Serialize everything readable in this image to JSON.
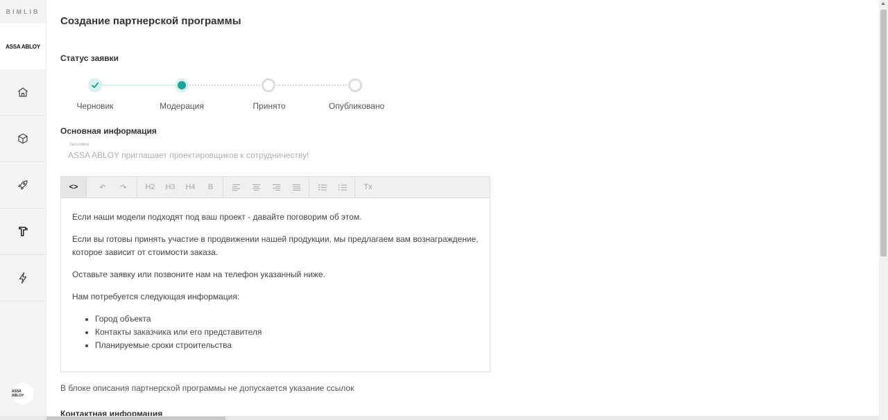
{
  "sidebar": {
    "brand": "BIMLIB",
    "company": "ASSA ABLOY",
    "avatar_text": "ASSA ABLOY",
    "nav": [
      {
        "icon": "home-icon"
      },
      {
        "icon": "cube-icon"
      },
      {
        "icon": "rocket-icon"
      },
      {
        "icon": "door-icon"
      },
      {
        "icon": "lightning-icon"
      }
    ]
  },
  "page": {
    "title": "Создание партнерской программы",
    "status_title": "Статус заявки",
    "steps": [
      {
        "label": "Черновик",
        "state": "done"
      },
      {
        "label": "Модерация",
        "state": "current"
      },
      {
        "label": "Принято",
        "state": "pending"
      },
      {
        "label": "Опубликовано",
        "state": "pending"
      }
    ],
    "main_info_title": "Основная информация",
    "subject_label": "Заголовок",
    "subject_value": "ASSA ABLOY приглашает проектировщиков к сотрудничеству!",
    "contact_title": "Контактная информация",
    "note": "В блоке описания партнерской программы не допускается указание ссылок"
  },
  "editor": {
    "toolbar": {
      "code": "<>",
      "undo": "↶",
      "redo": "↷",
      "h2": "H2",
      "h3": "H3",
      "h4": "H4",
      "bold": "B",
      "clear": "Tx"
    },
    "paragraphs": [
      "Если наши модели подходят под ваш проект - давайте поговорим об этом.",
      "Если вы готовы принять участие в продвижении нашей продукции, мы предлагаем вам вознаграждение, которое зависит от стоимости заказа.",
      "Оставьте заявку или позвоните нам на телефон указанный ниже.",
      "Нам потребуется следующая информация:"
    ],
    "bullets": [
      "Город объекта",
      "Контакты заказчика или его представителя",
      "Планируемые сроки строительства"
    ]
  },
  "colors": {
    "accent": "#1aa39a",
    "done_fill": "#d8f1ef",
    "pending_border": "#dcdcdc"
  }
}
